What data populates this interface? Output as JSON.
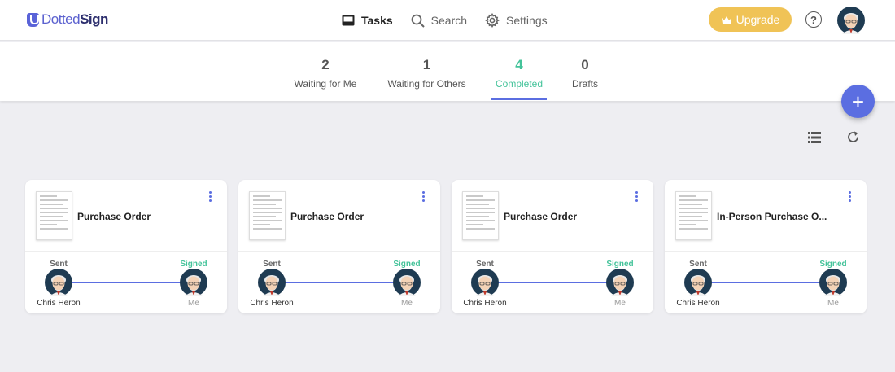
{
  "app": {
    "logo_prefix": "Dotted",
    "logo_suffix": "Sign"
  },
  "nav": {
    "tasks": "Tasks",
    "search": "Search",
    "settings": "Settings",
    "upgrade": "Upgrade",
    "help": "?"
  },
  "tabs": [
    {
      "count": "2",
      "label": "Waiting for Me"
    },
    {
      "count": "1",
      "label": "Waiting for Others"
    },
    {
      "count": "4",
      "label": "Completed"
    },
    {
      "count": "0",
      "label": "Drafts"
    }
  ],
  "active_tab": "Completed",
  "colors": {
    "accent": "#5b6ee1",
    "signed_green": "#44c39a",
    "upgrade": "#f0c356"
  },
  "fab_label": "+",
  "cards": [
    {
      "title": "Purchase Order",
      "sent_label": "Sent",
      "signed_label": "Signed",
      "sender": "Chris Heron",
      "signer": "Me"
    },
    {
      "title": "Purchase Order",
      "sent_label": "Sent",
      "signed_label": "Signed",
      "sender": "Chris Heron",
      "signer": "Me"
    },
    {
      "title": "Purchase Order",
      "sent_label": "Sent",
      "signed_label": "Signed",
      "sender": "Chris Heron",
      "signer": "Me"
    },
    {
      "title": "In-Person Purchase O...",
      "sent_label": "Sent",
      "signed_label": "Signed",
      "sender": "Chris Heron",
      "signer": "Me"
    }
  ]
}
